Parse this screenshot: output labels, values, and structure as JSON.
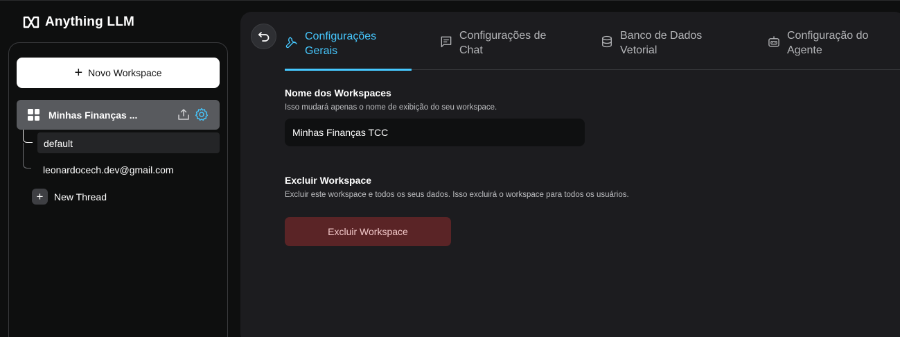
{
  "app": {
    "title": "Anything LLM"
  },
  "sidebar": {
    "new_workspace_label": "Novo Workspace",
    "workspace": {
      "name": "Minhas Finanças ..."
    },
    "threads": [
      {
        "label": "default",
        "active": true
      },
      {
        "label": "leonardocech.dev@gmail.com",
        "active": false
      }
    ],
    "new_thread_label": "New Thread"
  },
  "tabs": [
    {
      "line1": "Configurações",
      "line2": "Gerais",
      "icon": "wrench-icon",
      "active": true
    },
    {
      "line1": "Configurações de",
      "line2": "Chat",
      "icon": "chat-icon",
      "active": false
    },
    {
      "line1": "Banco de Dados",
      "line2": "Vetorial",
      "icon": "database-icon",
      "active": false
    },
    {
      "line1": "Configuração do",
      "line2": "Agente",
      "icon": "robot-icon",
      "active": false
    }
  ],
  "general": {
    "name_title": "Nome dos Workspaces",
    "name_desc": "Isso mudará apenas o nome de exibição do seu workspace.",
    "name_value": "Minhas Finanças TCC",
    "delete_title": "Excluir Workspace",
    "delete_desc": "Excluir este workspace e todos os seus dados. Isso excluirá o workspace para todos os usuários.",
    "delete_button": "Excluir Workspace"
  },
  "colors": {
    "accent": "#46c8ff",
    "danger_bg": "#5a2426",
    "panel_bg": "#1c1c1f",
    "page_bg": "#0e0f0f"
  }
}
